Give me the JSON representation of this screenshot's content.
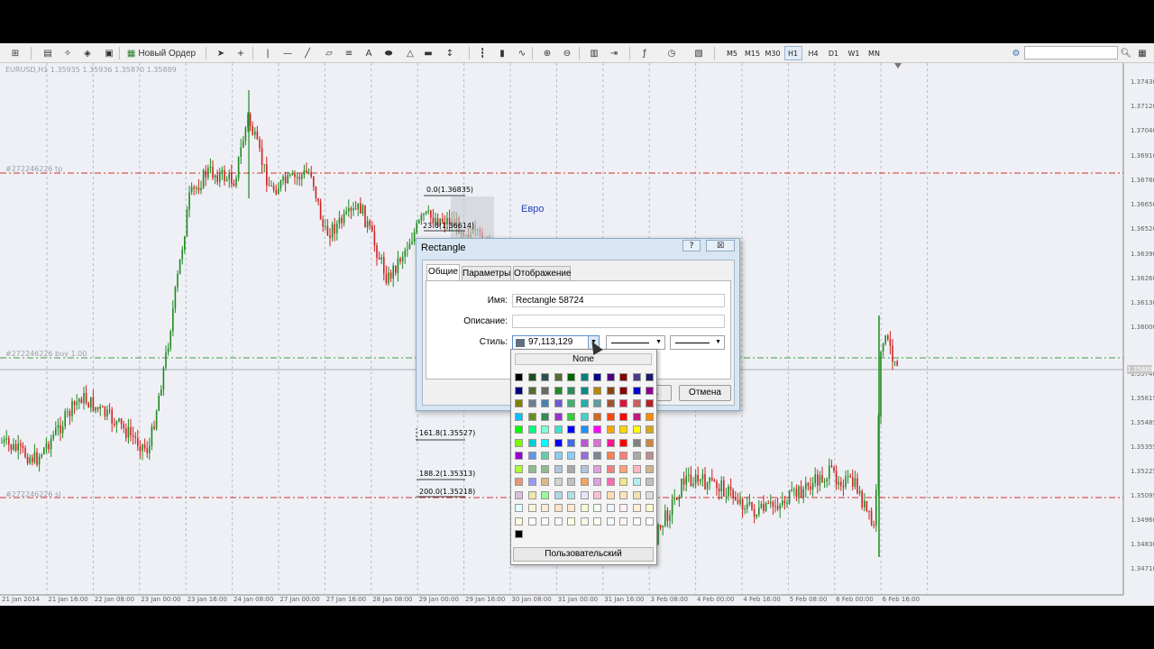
{
  "toolbar": {
    "new_order_label": "Новый Ордер",
    "icons": [
      "new-chart-icon",
      "profiles-icon",
      "navigator-icon",
      "market-watch-icon",
      "data-window-icon",
      "new-order-icon",
      "cursor-icon",
      "crosshair-icon",
      "vertical-line-icon",
      "horizontal-line-icon",
      "trendline-icon",
      "equidistant-channel-icon",
      "fibonacci-icon",
      "text-icon",
      "ellipse-icon",
      "triangle-icon",
      "rectangle-icon",
      "arrows-icon",
      "bar-chart-icon",
      "candles-icon",
      "line-chart-icon",
      "zoom-in-icon",
      "zoom-out-icon",
      "tile-windows-icon",
      "chart-shift-icon",
      "indicators-icon",
      "periods-icon",
      "templates-icon"
    ],
    "timeframes": [
      "M5",
      "M15",
      "M30",
      "H1",
      "H4",
      "D1",
      "W1",
      "MN"
    ],
    "active_timeframe": "H1"
  },
  "chart": {
    "symbol_info": "EURUSD,H1  1.35935 1.35936 1.35870 1.35889",
    "orders": [
      {
        "label": "#272246226 tp"
      },
      {
        "label": "#272246226 buy 1.00"
      },
      {
        "label": "#272246226 sl"
      }
    ],
    "fib_levels": [
      {
        "label": "0.0(1.36835)"
      },
      {
        "label": "23.6(1.36614)"
      },
      {
        "label": "161.8(1.35527)"
      },
      {
        "label": "188.2(1.35313)"
      },
      {
        "label": "200.0(1.35218)"
      }
    ],
    "annotation_text": "Евро",
    "price_axis": [
      "1.37430",
      "1.37120",
      "1.37040",
      "1.36910",
      "1.36780",
      "1.36650",
      "1.36520",
      "1.36390",
      "1.36260",
      "1.36130",
      "1.36000",
      "1.35889",
      "1.35740",
      "1.35615",
      "1.35485",
      "1.35355",
      "1.35225",
      "1.35095",
      "1.34960",
      "1.34830",
      "1.34710"
    ],
    "current_price": "1.35889",
    "time_axis": [
      "21 Jan 2014",
      "21 Jan 16:00",
      "22 Jan 08:00",
      "23 Jan 00:00",
      "23 Jan 16:00",
      "24 Jan 08:00",
      "27 Jan 00:00",
      "27 Jan 16:00",
      "28 Jan 08:00",
      "29 Jan 00:00",
      "29 Jan 16:00",
      "30 Jan 08:00",
      "31 Jan 00:00",
      "31 Jan 16:00",
      "3 Feb 08:00",
      "4 Feb 00:00",
      "4 Feb 16:00",
      "5 Feb 08:00",
      "6 Feb 00:00",
      "6 Feb 16:00"
    ],
    "colors": {
      "bull": "#1f8a1f",
      "bear": "#d22020",
      "grid": "#b8bcc6",
      "order_red": "#d23030",
      "order_green": "#40a040"
    }
  },
  "dialog": {
    "title": "Rectangle",
    "help_label": "?",
    "close_label": "☒",
    "tabs": [
      "Общие",
      "Параметры",
      "Отображение"
    ],
    "active_tab": "Общие",
    "name_label": "Имя:",
    "name_value": "Rectangle 58724",
    "description_label": "Описание:",
    "description_value": "",
    "style_label": "Стиль:",
    "color_value": "97,113,129",
    "color_swatch": "#617181",
    "ok_label": "OK",
    "cancel_label": "Отмена"
  },
  "palette": {
    "none_label": "None",
    "custom_label": "Пользовательский",
    "columns": 11,
    "colors": [
      "#000000",
      "#1e4d1e",
      "#2f4f4f",
      "#556b2f",
      "#006400",
      "#008080",
      "#00008b",
      "#4b0082",
      "#800000",
      "#483d8b",
      "#191970",
      "#000080",
      "#556b2f",
      "#696969",
      "#228b22",
      "#2e8b57",
      "#008b8b",
      "#b8860b",
      "#8b4513",
      "#8b0000",
      "#0000cd",
      "#8b008b",
      "#808000",
      "#708090",
      "#4682b4",
      "#6a5acd",
      "#3cb371",
      "#20b2aa",
      "#5f9ea0",
      "#a0522d",
      "#dc143c",
      "#cd5c5c",
      "#b22222",
      "#00bfff",
      "#6b8e23",
      "#2e8b57",
      "#9932cc",
      "#32cd32",
      "#48d1cc",
      "#d2691e",
      "#ff4500",
      "#ff0000",
      "#c71585",
      "#ff8c00",
      "#00ff00",
      "#00ff7f",
      "#7fffd4",
      "#40e0d0",
      "#0000ff",
      "#1e90ff",
      "#ff00ff",
      "#ffa500",
      "#ffd700",
      "#ffff00",
      "#daa520",
      "#7cfc00",
      "#00ced1",
      "#00ffff",
      "#0000ff",
      "#4169e1",
      "#ba55d3",
      "#da70d6",
      "#ff1493",
      "#ff0000",
      "#808080",
      "#cd853f",
      "#9400d3",
      "#6495ed",
      "#66cdaa",
      "#87ceeb",
      "#87cefa",
      "#9370db",
      "#778899",
      "#ff7f50",
      "#fa8072",
      "#a9a9a9",
      "#bc8f8f",
      "#adff2f",
      "#8fbc8f",
      "#8fbc8f",
      "#b0c4de",
      "#a9a9a9",
      "#b0c4de",
      "#dda0dd",
      "#f08080",
      "#ffa07a",
      "#ffb6c1",
      "#d2b48c",
      "#e9967a",
      "#9999ff",
      "#deb887",
      "#d3d3d3",
      "#c0c0c0",
      "#f4a460",
      "#dda0dd",
      "#ff69b4",
      "#f0e68c",
      "#afeeee",
      "#c0c0c0",
      "#d8bfd8",
      "#eee8aa",
      "#98fb98",
      "#add8e6",
      "#b0e0e6",
      "#e6e6fa",
      "#ffc0cb",
      "#ffdead",
      "#ffe4b5",
      "#f5deb3",
      "#dcdcdc",
      "#e0ffff",
      "#f5f5dc",
      "#faebd7",
      "#ffe4c4",
      "#ffebcd",
      "#fafad2",
      "#f0fff0",
      "#f0f8ff",
      "#fff0f5",
      "#ffefd5",
      "#fffacd",
      "#fff8dc",
      "#f5fffa",
      "#fffafa",
      "#f8f8ff",
      "#ffffe0",
      "#fdf5e6",
      "#fffff0",
      "#f0ffff",
      "#fff5ee",
      "#fcfcfc",
      "#ffffff",
      "#000000"
    ]
  }
}
